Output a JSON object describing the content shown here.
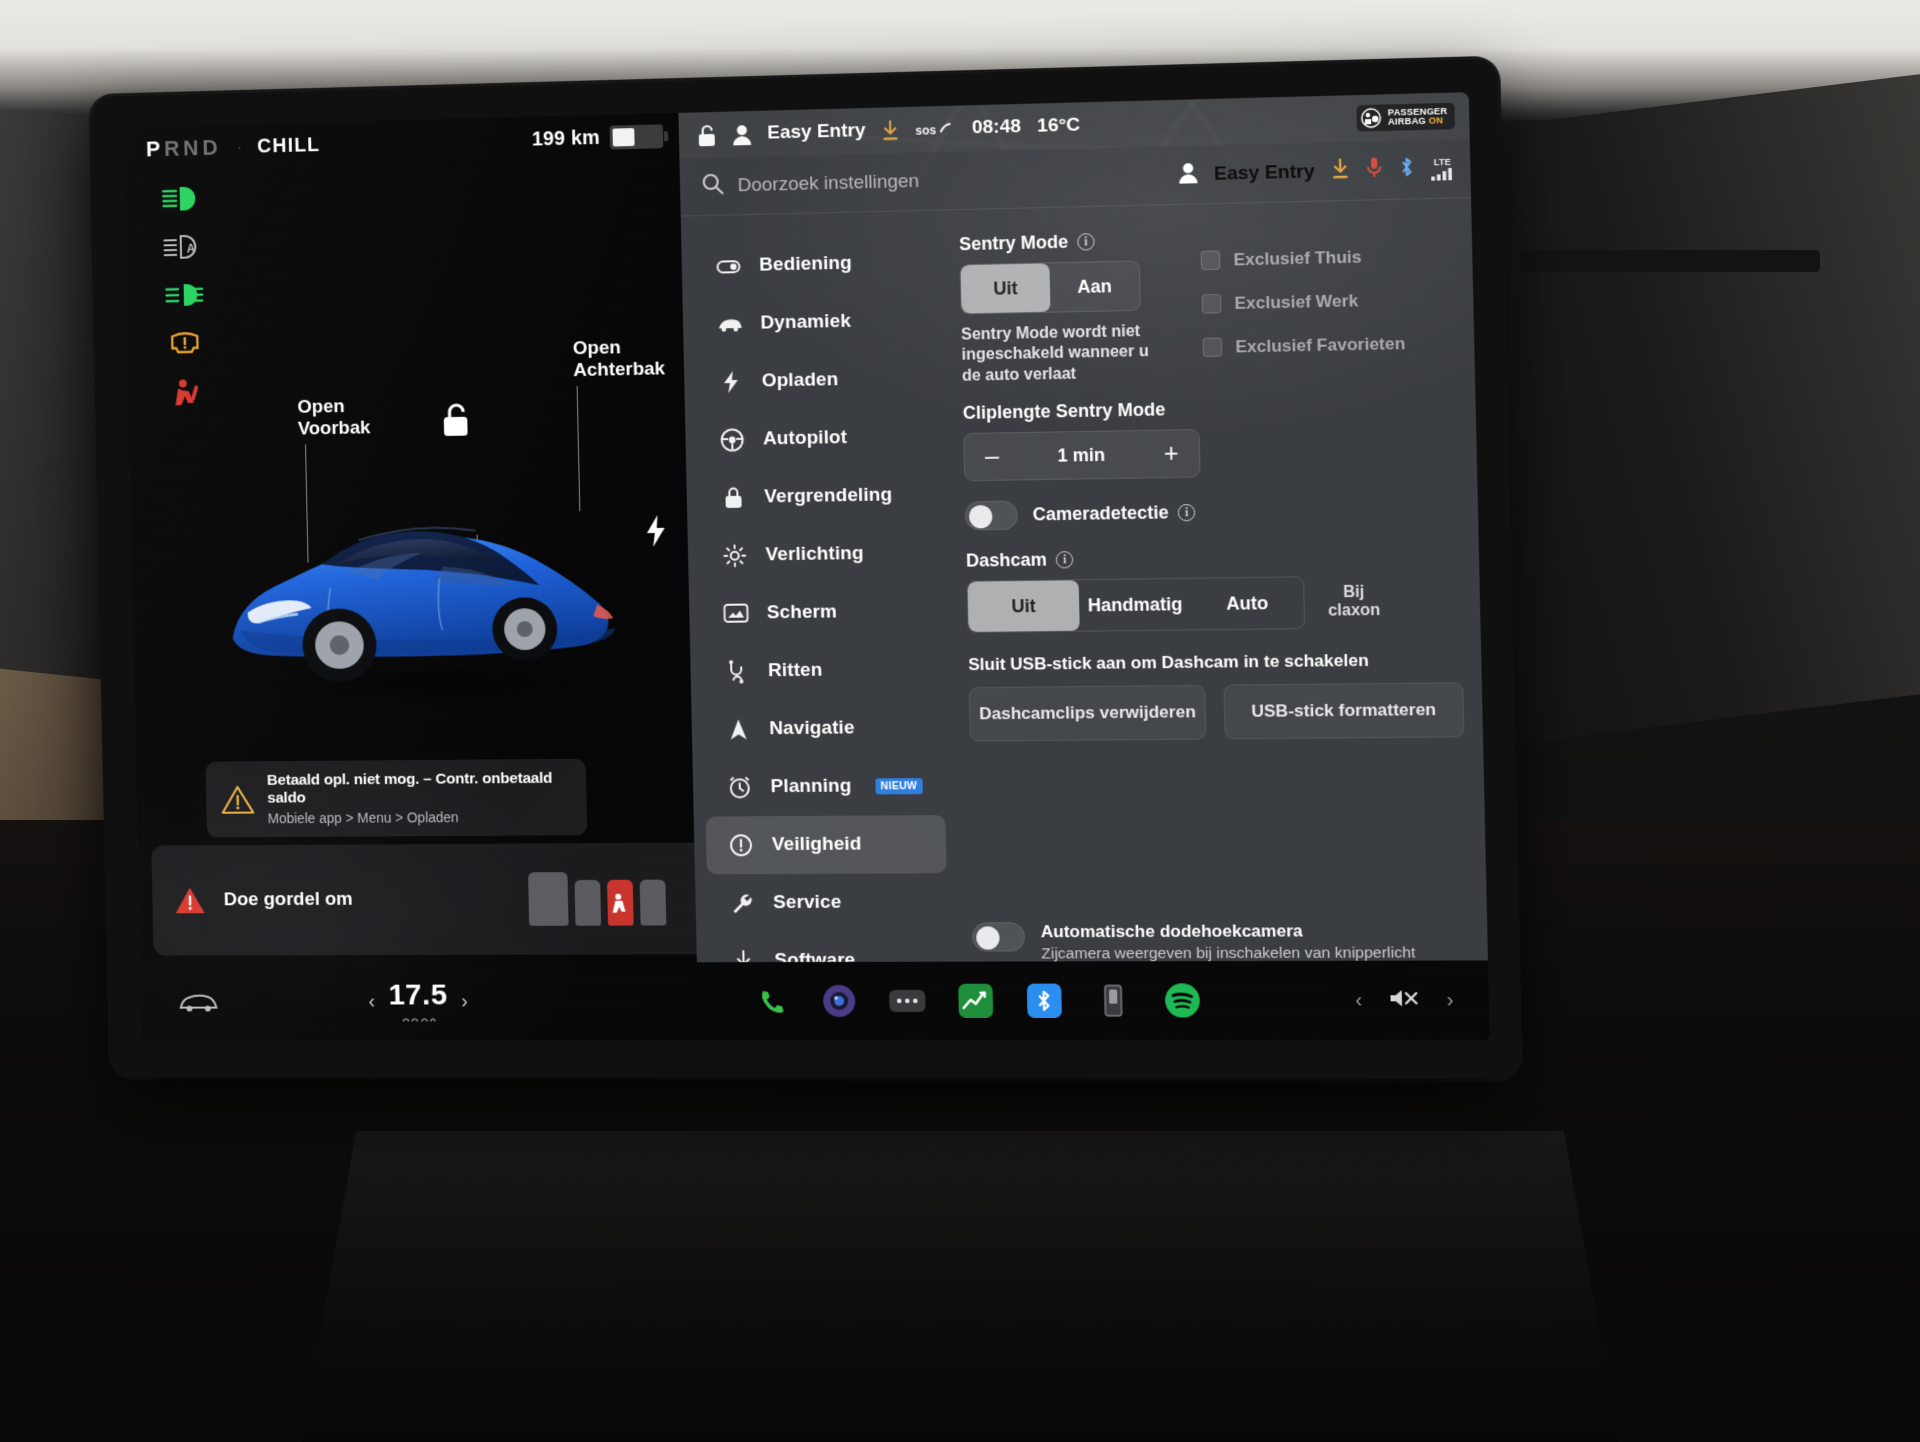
{
  "drive_status": {
    "prnd": {
      "p": "P",
      "rnd": "RND"
    },
    "mode": "CHILL",
    "range": "199 km",
    "battery_percent": 45,
    "telltales": [
      {
        "name": "high-beam-icon",
        "color": "#27d360"
      },
      {
        "name": "auto-high-beam-icon",
        "color": "#c9cbcd"
      },
      {
        "name": "fog-light-icon",
        "color": "#27d360"
      },
      {
        "name": "tire-pressure-warning-icon",
        "color": "#e8a12a"
      },
      {
        "name": "seatbelt-warning-icon",
        "color": "#d6362c"
      }
    ]
  },
  "car_view": {
    "callout_front": {
      "line1": "Open",
      "line2": "Voorbak"
    },
    "callout_rear": {
      "line1": "Open",
      "line2": "Achterbak"
    },
    "alert": {
      "title": "Betaald opl. niet mog. – Contr. onbetaald saldo",
      "subtitle": "Mobiele app > Menu > Opladen"
    },
    "seatbelt_alert": "Doe gordel om"
  },
  "top_bar": {
    "lock_icon": "unlocked-icon",
    "profile_icon": "person-icon",
    "profile_name": "Easy Entry",
    "download_icon": "download-icon",
    "sos_label": "sos",
    "time": "08:48",
    "temperature": "16°C",
    "airbag_badge": {
      "line1": "PASSENGER",
      "line2": "AIRBAG",
      "state": "ON"
    }
  },
  "search": {
    "placeholder": "Doorzoek instellingen",
    "profile_name": "Easy Entry",
    "lte_label": "LTE"
  },
  "menu": {
    "items": [
      {
        "label": "Bediening",
        "icon": "toggle-icon",
        "active": false
      },
      {
        "label": "Dynamiek",
        "icon": "car-icon",
        "active": false
      },
      {
        "label": "Opladen",
        "icon": "bolt-icon",
        "active": false
      },
      {
        "label": "Autopilot",
        "icon": "steering-wheel-icon",
        "active": false
      },
      {
        "label": "Vergrendeling",
        "icon": "lock-icon",
        "active": false
      },
      {
        "label": "Verlichting",
        "icon": "brightness-icon",
        "active": false
      },
      {
        "label": "Scherm",
        "icon": "display-icon",
        "active": false
      },
      {
        "label": "Ritten",
        "icon": "route-icon",
        "active": false
      },
      {
        "label": "Navigatie",
        "icon": "navigation-arrow-icon",
        "active": false
      },
      {
        "label": "Planning",
        "icon": "clock-icon",
        "active": false,
        "badge": "NIEUW"
      },
      {
        "label": "Veiligheid",
        "icon": "shield-alert-icon",
        "active": true
      },
      {
        "label": "Service",
        "icon": "wrench-icon",
        "active": false
      },
      {
        "label": "Software",
        "icon": "download-icon",
        "active": false
      }
    ]
  },
  "safety": {
    "sentry": {
      "title": "Sentry Mode",
      "options": [
        "Uit",
        "Aan"
      ],
      "selected": "Uit",
      "helper": "Sentry Mode wordt niet ingeschakeld wanneer u de auto verlaat",
      "exclusions": [
        {
          "label": "Exclusief Thuis",
          "checked": false
        },
        {
          "label": "Exclusief Werk",
          "checked": false
        },
        {
          "label": "Exclusief Favorieten",
          "checked": false
        }
      ]
    },
    "clip_length": {
      "title": "Cliplengte Sentry Mode",
      "minus": "–",
      "value": "1 min",
      "plus": "+"
    },
    "camera_detection": {
      "label": "Cameradetectie",
      "enabled": false
    },
    "dashcam": {
      "title": "Dashcam",
      "options": [
        "Uit",
        "Handmatig",
        "Auto"
      ],
      "selected": "Uit",
      "extra_label_l1": "Bij",
      "extra_label_l2": "claxon",
      "usb_note": "Sluit USB-stick aan om Dashcam in te schakelen",
      "buttons": [
        "Dashcamclips verwijderen",
        "USB-stick formatteren"
      ]
    },
    "blind_spot": {
      "title": "Automatische dodehoekcamera",
      "subtitle": "Zijcamera weergeven bij inschakelen van knipperlicht",
      "enabled": false
    }
  },
  "dock": {
    "temperature": "17.5",
    "car_icon": "car-icon",
    "apps": [
      {
        "name": "phone-icon",
        "color": "#38c249"
      },
      {
        "name": "camera-icon",
        "color": "#6b4fb0"
      },
      {
        "name": "more-apps-icon",
        "color": "#3a3a3d"
      },
      {
        "name": "energy-chart-icon",
        "color": "#2fa94f"
      },
      {
        "name": "bluetooth-audio-icon",
        "color": "#2a8ef0"
      },
      {
        "name": "usb-storage-icon",
        "color": "#56585b"
      },
      {
        "name": "spotify-icon",
        "color": "#1db954"
      }
    ],
    "mute_icon": "volume-mute-icon",
    "prev_icon": "chevron-left-icon",
    "next_icon": "chevron-right-icon"
  },
  "colors": {
    "accent_blue": "#2f7fe0",
    "warn_amber": "#e8a12a",
    "danger_red": "#d6362c",
    "green": "#27d360",
    "panel": "#3c3f42",
    "selected_seg": "#aeb0b2"
  }
}
